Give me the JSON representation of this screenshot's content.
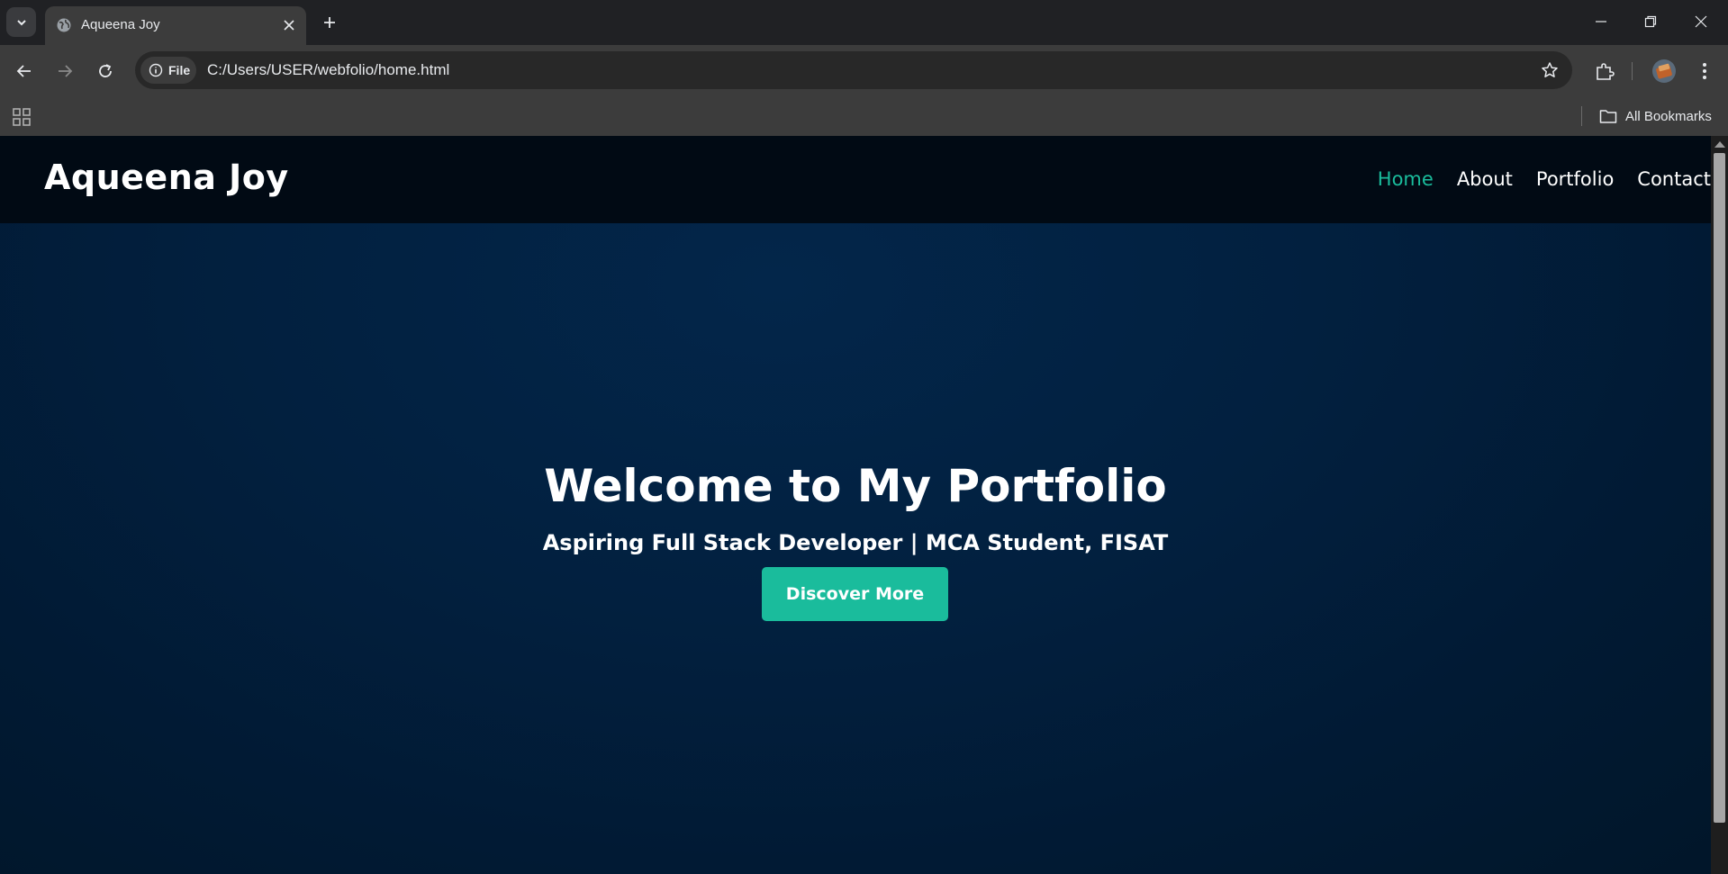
{
  "browser": {
    "tab": {
      "title": "Aqueena Joy"
    },
    "omnibox": {
      "chip_label": "File",
      "url": "C:/Users/USER/webfolio/home.html"
    },
    "bookmarks": {
      "all_label": "All Bookmarks"
    }
  },
  "site": {
    "brand": "Aqueena Joy",
    "nav": [
      {
        "label": "Home",
        "active": true
      },
      {
        "label": "About",
        "active": false
      },
      {
        "label": "Portfolio",
        "active": false
      },
      {
        "label": "Contact",
        "active": false
      }
    ],
    "hero": {
      "title": "Welcome to My Portfolio",
      "subtitle": "Aspiring Full Stack Developer | MCA Student, FISAT",
      "cta_label": "Discover More"
    }
  },
  "colors": {
    "accent": "#1abc9c",
    "header_bg": "#010a14",
    "hero_bg": "#02203f"
  },
  "icons": [
    "chevron-down-icon",
    "globe-icon",
    "close-icon",
    "plus-icon",
    "minimize-icon",
    "restore-icon",
    "back-icon",
    "forward-icon",
    "reload-icon",
    "info-icon",
    "star-icon",
    "extensions-icon",
    "profile-avatar",
    "more-icon",
    "apps-icon",
    "folder-icon"
  ]
}
